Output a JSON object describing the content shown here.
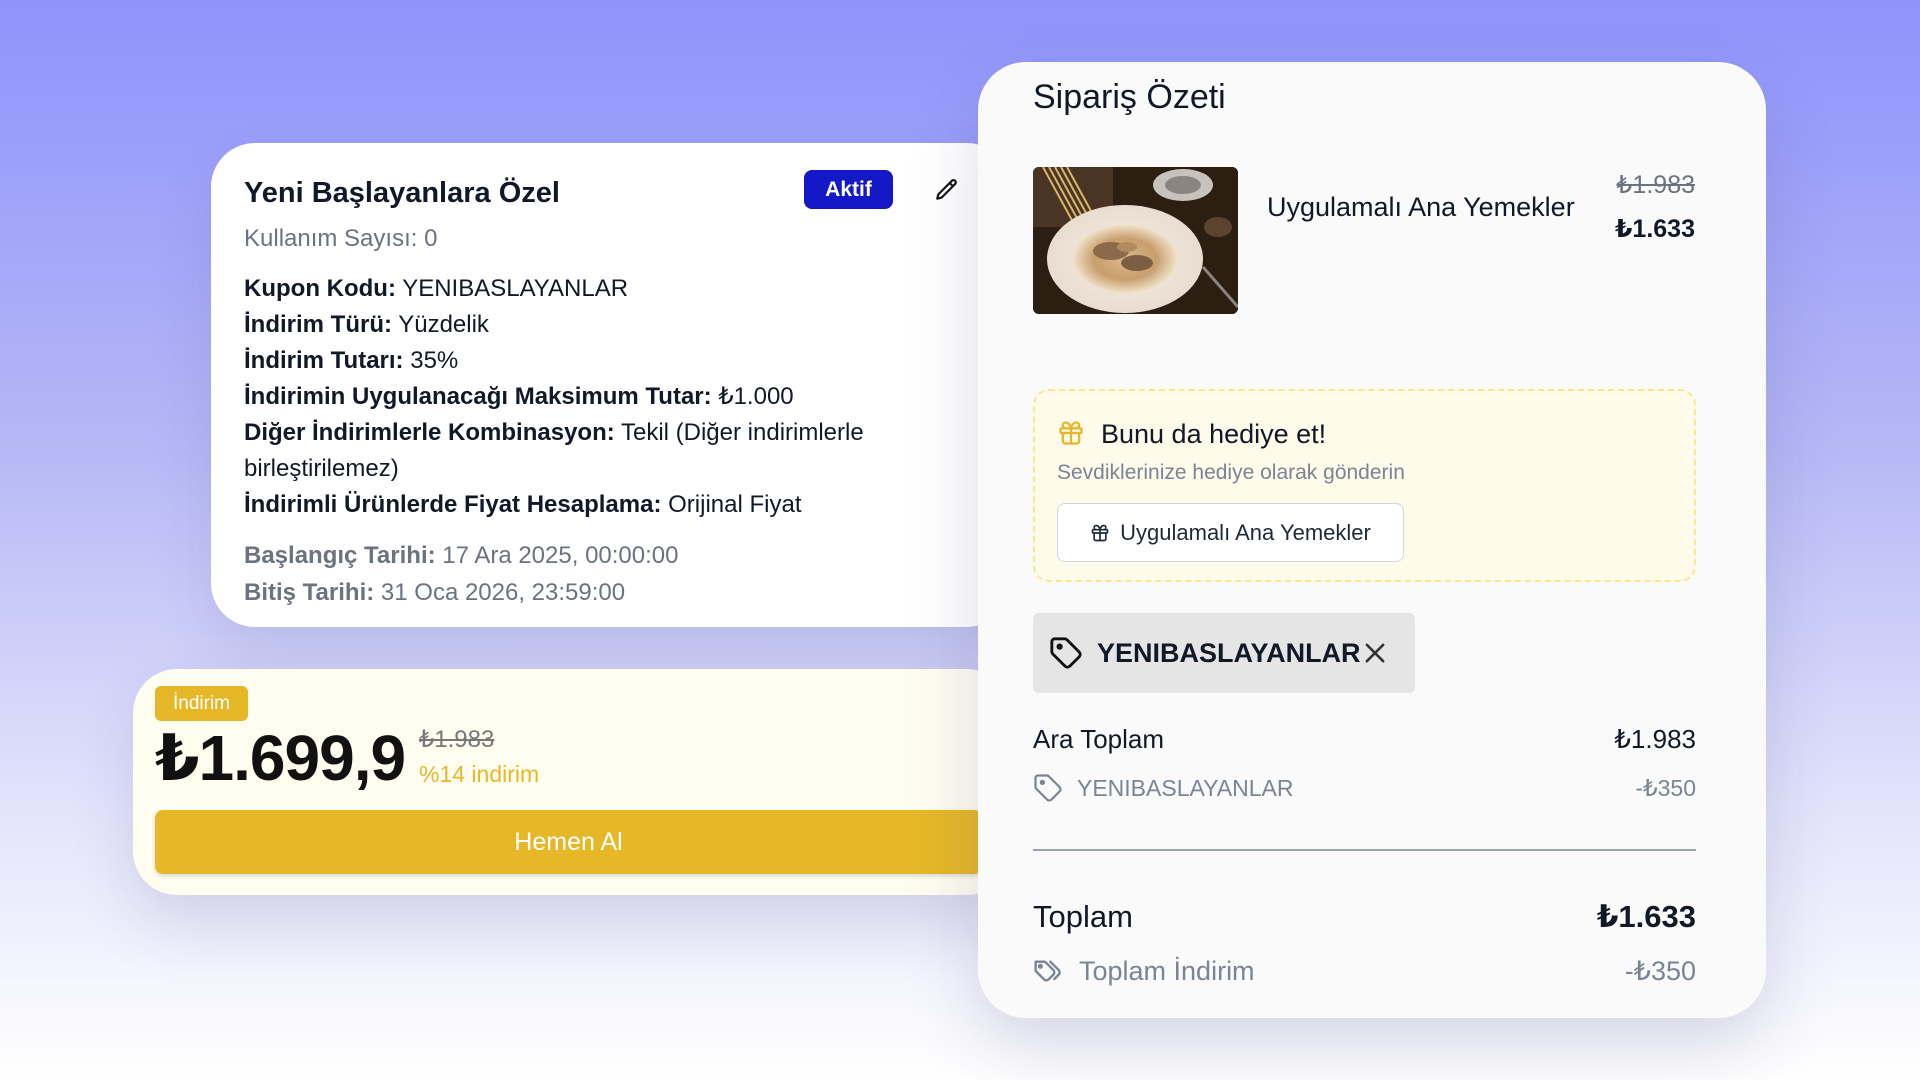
{
  "coupon": {
    "title": "Yeni Başlayanlara Özel",
    "status": "Aktif",
    "usage": "Kullanım Sayısı: 0",
    "fields": [
      {
        "label": "Kupon Kodu:",
        "value": "YENIBASLAYANLAR"
      },
      {
        "label": "İndirim Türü:",
        "value": "Yüzdelik"
      },
      {
        "label": "İndirim Tutarı:",
        "value": "35%"
      },
      {
        "label": "İndirimin Uygulanacağı Maksimum Tutar:",
        "value": "₺1.000"
      },
      {
        "label": "Diğer İndirimlerle Kombinasyon:",
        "value": "Tekil (Diğer indirimlerle birleştirilemez)"
      },
      {
        "label": "İndirimli Ürünlerde Fiyat Hesaplama:",
        "value": "Orijinal Fiyat"
      }
    ],
    "start_label": "Başlangıç Tarihi:",
    "start_value": "17 Ara 2025, 00:00:00",
    "end_label": "Bitiş Tarihi:",
    "end_value": "31 Oca 2026, 23:59:00"
  },
  "price_card": {
    "tag": "İndirim",
    "price": "₺1.699,9",
    "old_price": "₺1.983",
    "discount_pct": "%14 indirim",
    "buy_label": "Hemen Al"
  },
  "summary": {
    "title": "Sipariş Özeti",
    "product": {
      "name": "Uygulamalı Ana Yemekler",
      "old_price": "₺1.983",
      "new_price": "₺1.633"
    },
    "gift": {
      "title": "Bunu da hediye et!",
      "subtitle": "Sevdiklerinize hediye olarak gönderin",
      "button": "Uygulamalı Ana Yemekler"
    },
    "applied_coupon": "YENIBASLAYANLAR",
    "subtotal_label": "Ara Toplam",
    "subtotal_value": "₺1.983",
    "coupon_line_label": "YENIBASLAYANLAR",
    "coupon_line_value": "-₺350",
    "total_label": "Toplam",
    "total_value": "₺1.633",
    "total_discount_label": "Toplam İndirim",
    "total_discount_value": "-₺350"
  },
  "colors": {
    "badge": "#1418c7",
    "accent_yellow": "#e6b828",
    "gift_bg": "#fffbeb"
  },
  "icons": [
    "edit-pencil-icon",
    "gift-icon",
    "tag-icon",
    "close-icon",
    "tags-icon"
  ]
}
